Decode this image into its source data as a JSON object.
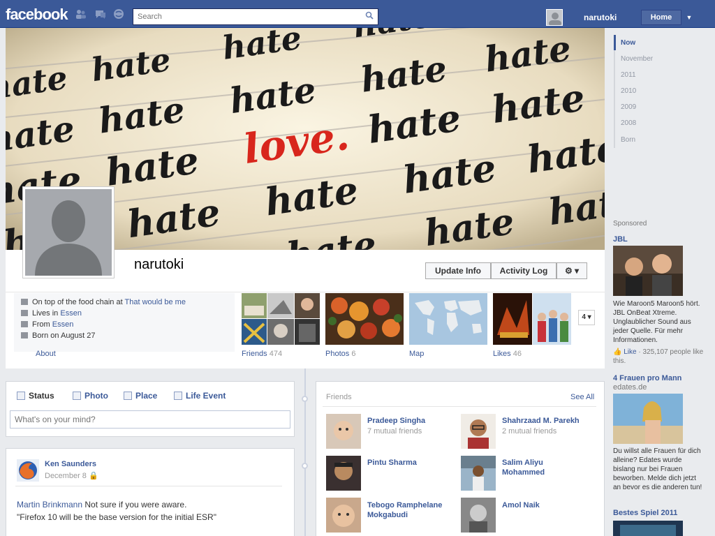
{
  "topbar": {
    "logo": "facebook",
    "search_placeholder": "Search",
    "user_name": "narutoki",
    "home_label": "Home",
    "menu_glyph": "▼"
  },
  "cover": {
    "words": {
      "hate": "hate",
      "love": "love."
    }
  },
  "profile": {
    "name": "narutoki",
    "buttons": {
      "update_info": "Update Info",
      "activity_log": "Activity Log",
      "settings": "⚙ ▾"
    }
  },
  "info": {
    "work_prefix": "On top of the food chain at ",
    "work_link": "That would be me",
    "lives_prefix": "Lives in ",
    "lives_link": "Essen",
    "from_prefix": "From ",
    "from_link": "Essen",
    "born": "Born on August 27",
    "about_label": "About"
  },
  "tiles": {
    "friends": {
      "label": "Friends",
      "count": "474"
    },
    "photos": {
      "label": "Photos",
      "count": "6"
    },
    "map": {
      "label": "Map"
    },
    "likes": {
      "label": "Likes",
      "count": "46"
    },
    "more": "4 ▾"
  },
  "composer": {
    "tabs": {
      "status": "Status",
      "photo": "Photo",
      "place": "Place",
      "life_event": "Life Event"
    },
    "placeholder": "What's on your mind?"
  },
  "post": {
    "author": "Ken Saunders",
    "date": "December 8",
    "mention": "Martin Brinkmann",
    "line1_text": " Not sure if you were aware.",
    "line2": "\"Firefox 10 will be the base version for the initial ESR\""
  },
  "friends_box": {
    "title": "Friends",
    "see_all": "See All",
    "items": [
      {
        "name": "Pradeep Singha",
        "mutual": "7 mutual friends"
      },
      {
        "name": "Shahrzaad M. Parekh",
        "mutual": "2 mutual friends"
      },
      {
        "name": "Pintu Sharma",
        "mutual": ""
      },
      {
        "name_line1": "Salim Aliyu",
        "name_line2": "Mohammed",
        "mutual": ""
      },
      {
        "name_line1": "Tebogo Ramphelane",
        "name_line2": "Mokgabudi",
        "mutual": ""
      },
      {
        "name": "Amol Naik",
        "mutual": ""
      }
    ]
  },
  "scrubber": [
    "Now",
    "November",
    "2011",
    "2010",
    "2009",
    "2008",
    "Born"
  ],
  "sponsored": {
    "label": "Sponsored",
    "ads": [
      {
        "title": "JBL",
        "text": "Wie Maroon5 Maroon5 hört. JBL OnBeat Xtreme. Unglaublicher Sound aus jeder Quelle. Für mehr Informationen.",
        "like_label": "Like",
        "like_count": " · 325,107 people like this."
      },
      {
        "title": "4 Frauen pro Mann",
        "subtitle": "edates.de",
        "text": "Du willst alle Frauen für dich alleine? Edates wurde bislang nur bei Frauen beworben. Melde dich jetzt an bevor es die anderen tun!"
      },
      {
        "title": "Bestes Spiel 2011"
      }
    ]
  },
  "colors": {
    "brand": "#3b5998",
    "love_red": "#d8261c"
  }
}
